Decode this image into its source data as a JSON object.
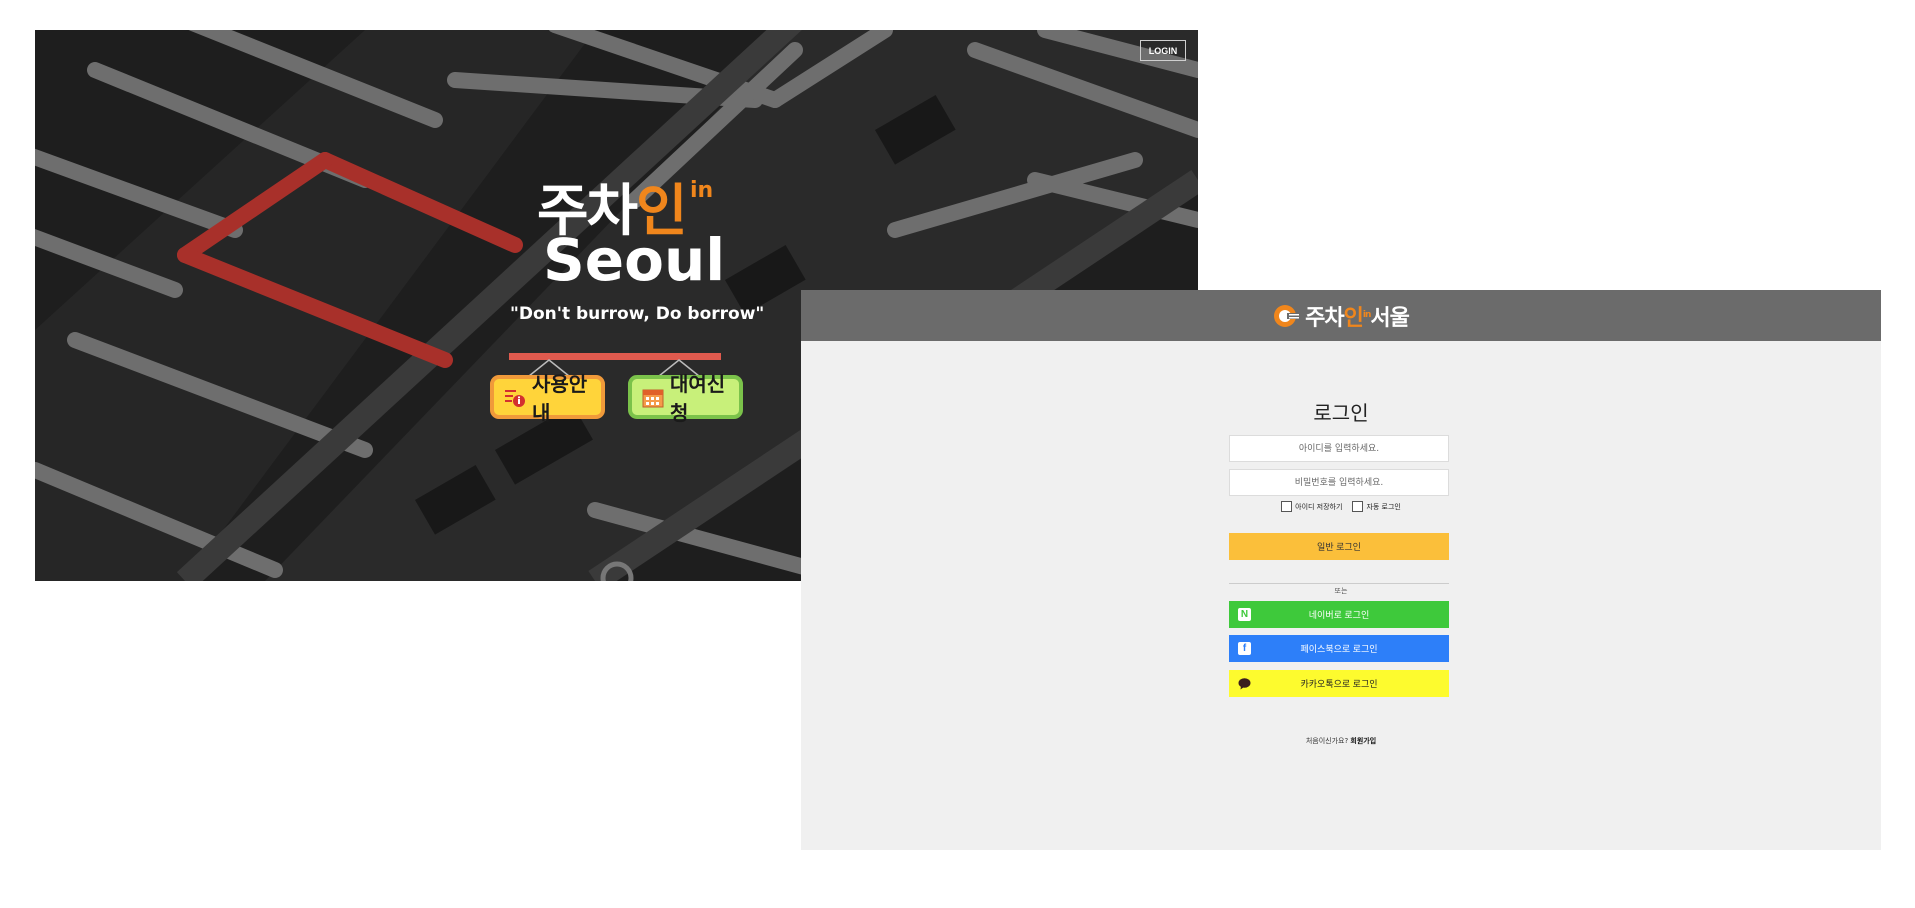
{
  "landing": {
    "login_link": "LOGIN",
    "logo_ko_main": "주차",
    "logo_ko_accent": "인",
    "logo_sup": "in",
    "logo_en": "Seoul",
    "tagline": "\"Don't burrow, Do borrow\"",
    "sign_guide_label": "사용안내",
    "sign_rent_label": "대여신청",
    "colors": {
      "accent": "#f0861c",
      "red_line": "#c0302a",
      "guide_sign": "#ffd43a",
      "rent_sign": "#c8f07a"
    }
  },
  "login": {
    "brand_main": "주차",
    "brand_accent": "인",
    "brand_sup": "in",
    "brand_suffix": "서울",
    "title": "로그인",
    "id_placeholder": "아이디를 입력하세요.",
    "pw_placeholder": "비밀번호를 입력하세요.",
    "remember_id_label": "아이디 저장하기",
    "auto_login_label": "자동 로그인",
    "normal_login_label": "일반 로그인",
    "or_label": "또는",
    "naver_label": "네이버로 로그인",
    "facebook_label": "페이스북으로 로그인",
    "kakao_label": "카카오톡으로 로그인",
    "signup_prompt": "처음이신가요? ",
    "signup_link": "회원가입",
    "icons": {
      "naver": "N",
      "facebook": "f",
      "kakao": "💬"
    },
    "colors": {
      "header": "#6b6b6b",
      "normal_btn": "#fbbf3a",
      "naver": "#3ec93b",
      "facebook": "#2d7ff9",
      "kakao": "#fdfb2e"
    }
  }
}
